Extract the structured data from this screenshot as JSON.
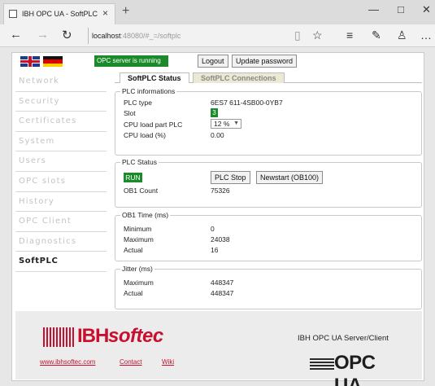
{
  "browser": {
    "tab_title": "IBH OPC UA - SoftPLC",
    "tab_close": "×",
    "new_tab": "+",
    "win_minimize": "—",
    "win_maximize": "□",
    "win_close": "✕",
    "url_host": "localhost",
    "url_rest": ":48080/#_=/softplc",
    "back": "←",
    "forward": "→",
    "reload": "↻",
    "reading_view": "▯",
    "favorite": "☆",
    "hub": "≡",
    "notes": "✎",
    "share": "♙",
    "more": "…"
  },
  "header": {
    "status_text": "OPC server is running",
    "logout_label": "Logout",
    "update_password_label": "Update password"
  },
  "sidebar": {
    "items": [
      {
        "label": "Network"
      },
      {
        "label": "Security"
      },
      {
        "label": "Certificates"
      },
      {
        "label": "System"
      },
      {
        "label": "Users"
      },
      {
        "label": "OPC slots"
      },
      {
        "label": "History"
      },
      {
        "label": "OPC Client"
      },
      {
        "label": "Diagnostics"
      },
      {
        "label": "SoftPLC"
      }
    ],
    "active": "SoftPLC"
  },
  "content": {
    "tabs": [
      {
        "label": "SoftPLC Status"
      },
      {
        "label": "SoftPLC Connections"
      }
    ],
    "plc_info": {
      "legend": "PLC informations",
      "plc_type_label": "PLC type",
      "plc_type_value": "6ES7 611-4SB00-0YB7",
      "slot_label": "Slot",
      "slot_value": "3",
      "cpu_load_part_label": "CPU load part PLC",
      "cpu_load_part_value": "12 %",
      "cpu_load_label": "CPU load (%)",
      "cpu_load_value": "0.00"
    },
    "plc_status": {
      "legend": "PLC Status",
      "run_label": "RUN",
      "stop_button": "PLC Stop",
      "newstart_button": "Newstart (OB100)",
      "ob1_count_label": "OB1 Count",
      "ob1_count_value": "75326"
    },
    "ob1_time": {
      "legend": "OB1 Time (ms)",
      "minimum_label": "Minimum",
      "minimum_value": "0",
      "maximum_label": "Maximum",
      "maximum_value": "24038",
      "actual_label": "Actual",
      "actual_value": "16"
    },
    "jitter": {
      "legend": "Jitter (ms)",
      "maximum_label": "Maximum",
      "maximum_value": "448347",
      "actual_label": "Actual",
      "actual_value": "448347"
    }
  },
  "footer": {
    "logo_bh": "IBH",
    "logo_soft": "softec",
    "link_website": "www.ibhsoftec.com",
    "link_contact": "Contact",
    "link_wiki": "Wiki",
    "product_name": "IBH OPC UA Server/Client",
    "opcua_logo": "OPC UA"
  }
}
